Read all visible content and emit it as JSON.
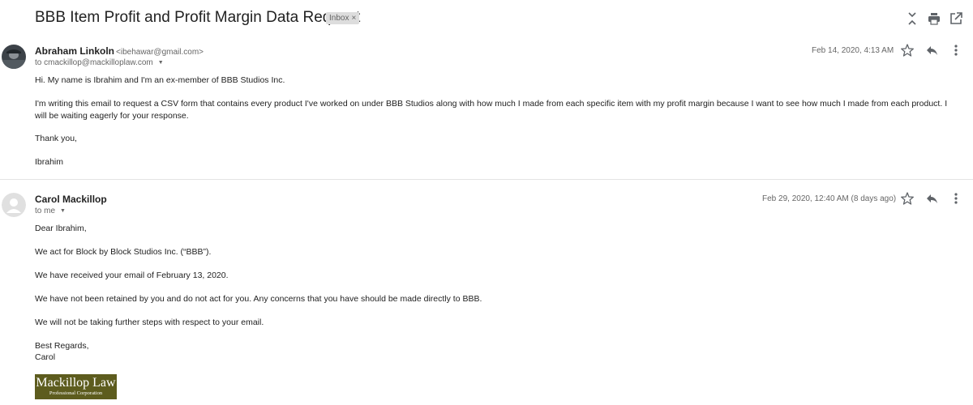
{
  "thread": {
    "subject": "BBB Item Profit and Profit Margin Data Request",
    "label": "Inbox",
    "label_remove": "×",
    "header_icons": [
      "collapse-all-icon",
      "print-icon",
      "open-in-new-window-icon"
    ]
  },
  "messages": [
    {
      "sender_name": "Abraham Linkoln",
      "sender_email": "<ibehawar@gmail.com>",
      "to_line": "to cmackillop@mackilloplaw.com",
      "date": "Feb 14, 2020, 4:13 AM",
      "body": [
        "Hi. My name is Ibrahim and I'm an ex-member of BBB Studios Inc.",
        "I'm writing this email to request a CSV form that contains every product I've worked on under BBB Studios along with how much I made from each specific item with my profit margin because I want to see how much I made from each product. I will be waiting eagerly for your response.",
        "Thank you,",
        "Ibrahim"
      ]
    },
    {
      "sender_name": "Carol Mackillop",
      "sender_email": "",
      "to_line": "to me",
      "date": "Feb 29, 2020, 12:40 AM (8 days ago)",
      "body": [
        "Dear Ibrahim,",
        "We act for Block by Block Studios Inc. (“BBB”).",
        "We have received your email of February 13, 2020.",
        "We have not been retained by you and do not act for you. Any concerns that you have should be made directly to BBB.",
        "We will not be taking further steps with respect to your email.",
        "Best Regards,",
        "Carol"
      ],
      "signature_logo": {
        "line1": "Mackillop Law",
        "line2": "Professional Corporation"
      }
    }
  ],
  "colors": {
    "logo_background": "#5d5c1e",
    "label_chip": "#dddddd",
    "icon_gray": "#5f6368",
    "divider": "#e4e4e4"
  }
}
